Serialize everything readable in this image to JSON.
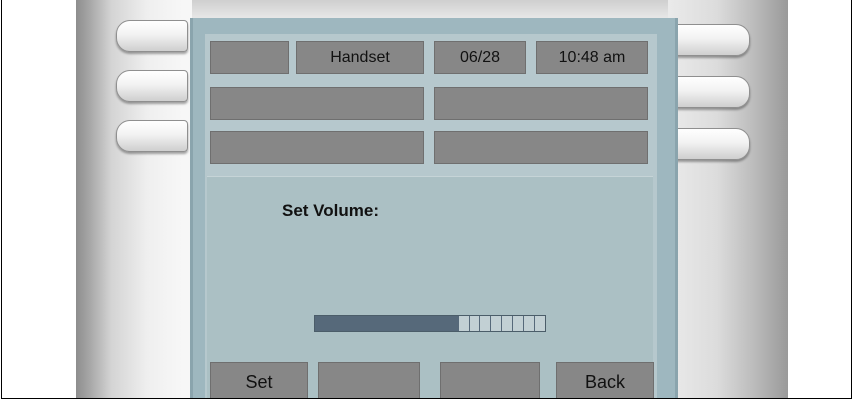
{
  "status_bar": {
    "line_label": "",
    "audio_mode": "Handset",
    "date": "06/28",
    "time": "10:48 am"
  },
  "feature_keys": [
    "",
    "",
    "",
    ""
  ],
  "main": {
    "prompt": "Set Volume:",
    "volume_level": 0.62,
    "volume_segments_empty": 8
  },
  "softkeys": [
    "Set",
    "",
    "",
    "Back"
  ],
  "side_keys": {
    "left": [
      "line-key",
      "line-key",
      "line-key"
    ],
    "right": [
      "line-key",
      "line-key",
      "line-key"
    ]
  }
}
